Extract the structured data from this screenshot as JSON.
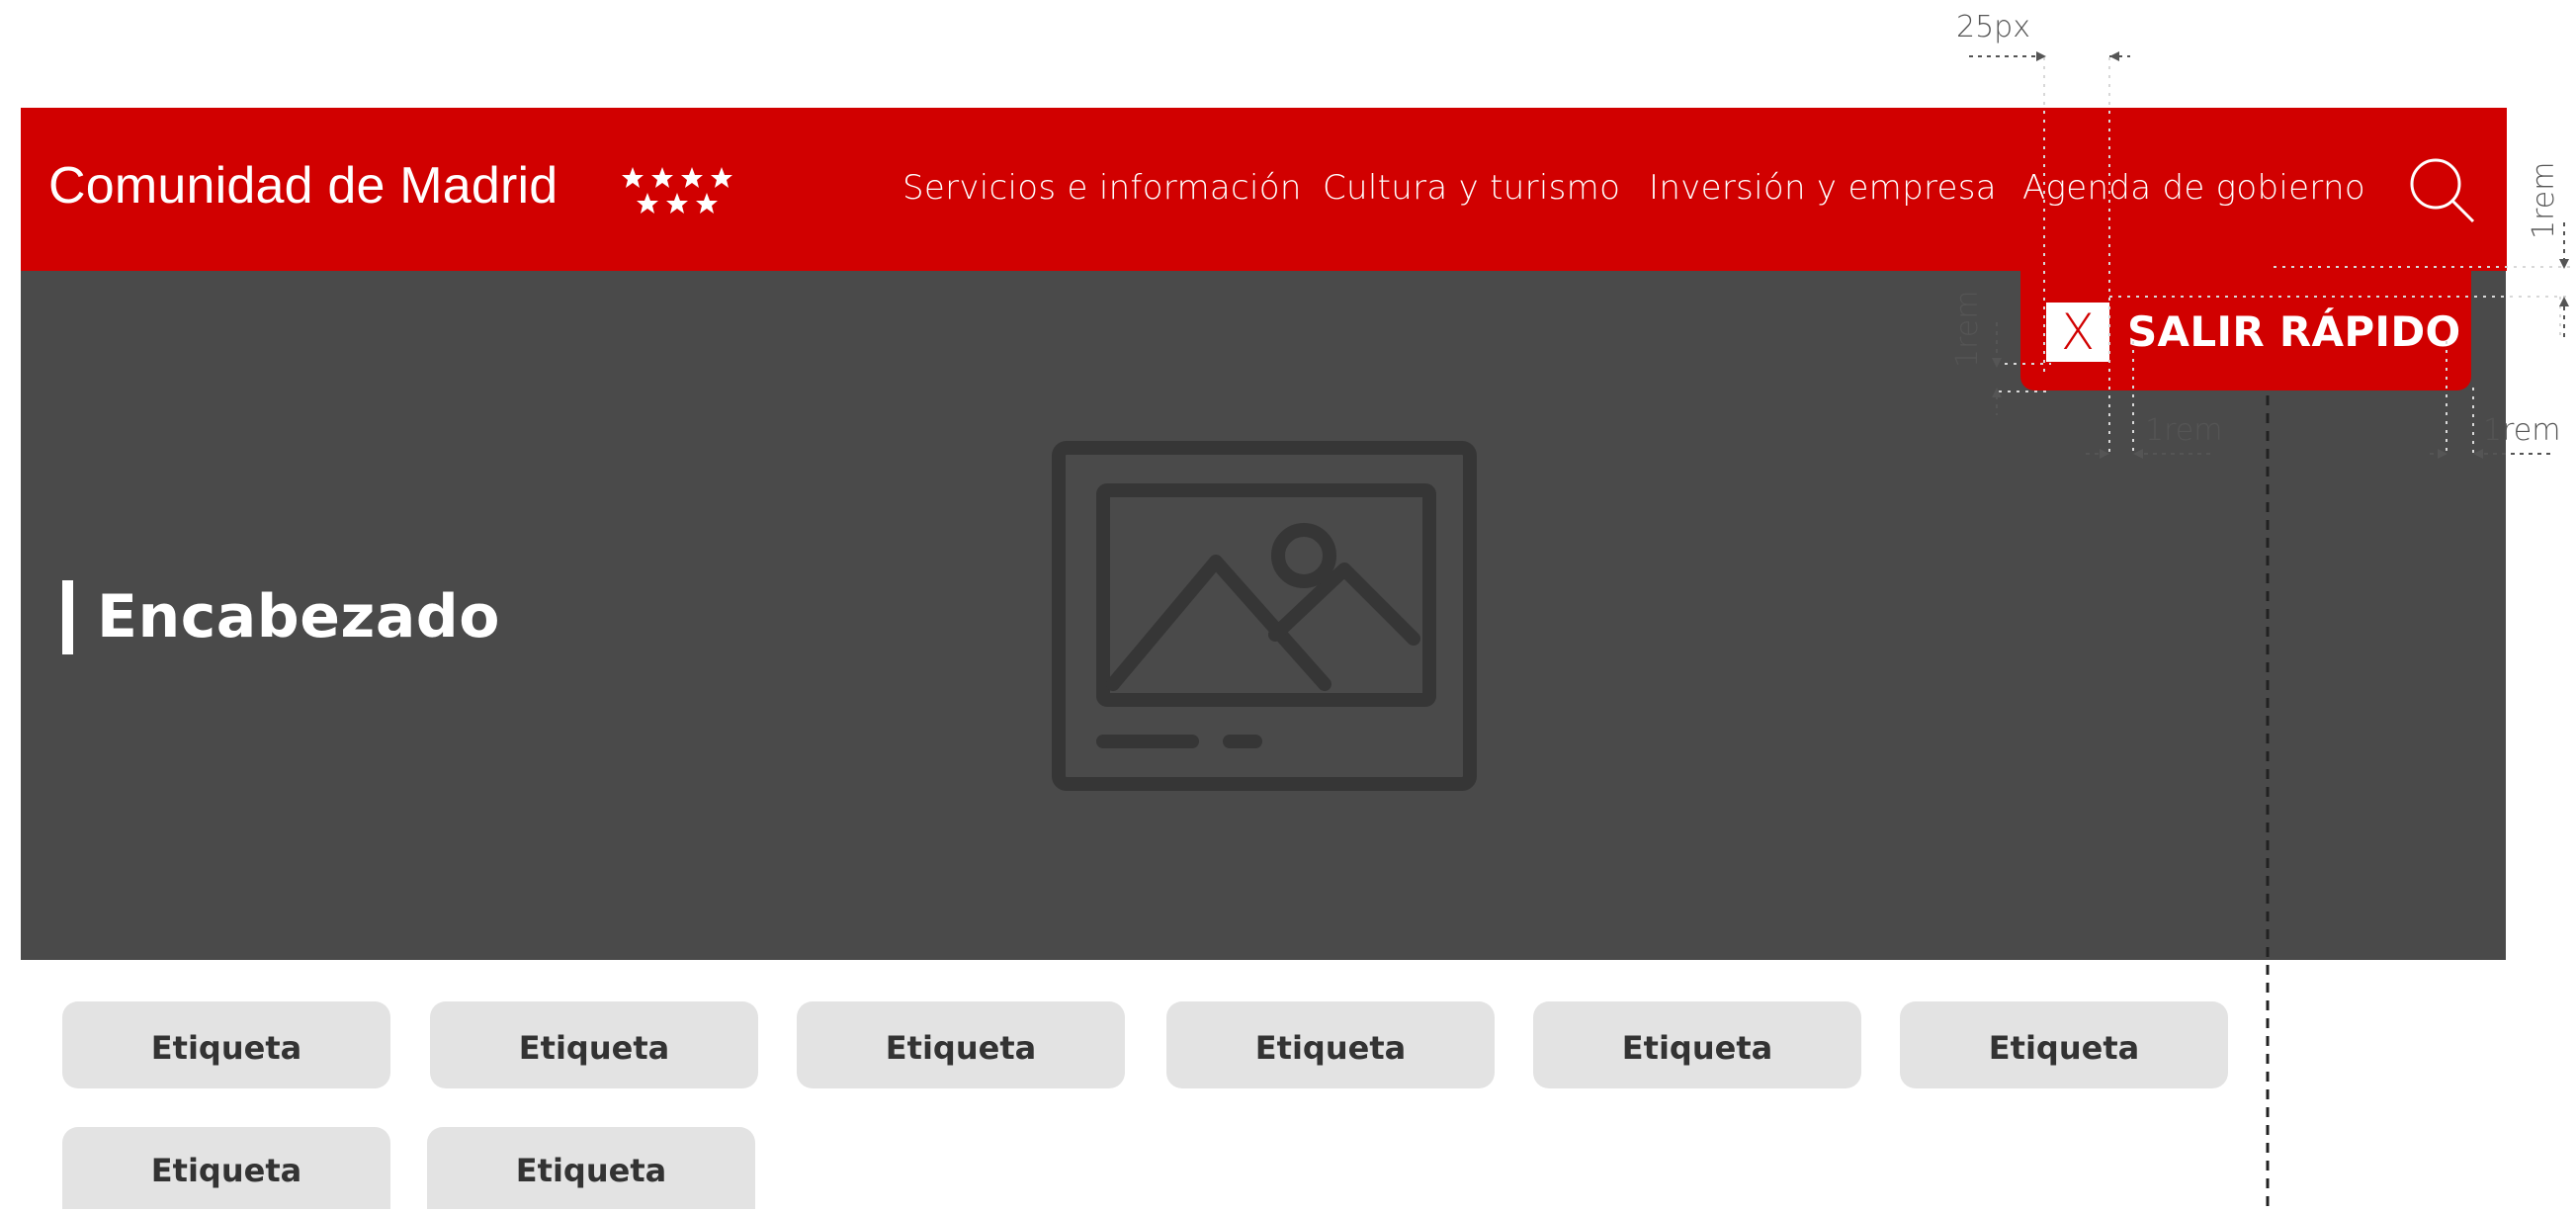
{
  "header": {
    "logo_text": "Comunidad de Madrid",
    "nav": [
      {
        "label": "Servicios e información"
      },
      {
        "label": "Cultura y turismo"
      },
      {
        "label": "Inversión y empresa"
      },
      {
        "label": "Agenda de gobierno"
      }
    ],
    "search_icon": "search-icon"
  },
  "quick_exit": {
    "icon_label": "X",
    "label": "SALIR RÁPIDO"
  },
  "hero": {
    "title": "Encabezado",
    "image_icon": "image-placeholder-icon"
  },
  "tags": [
    "Etiqueta",
    "Etiqueta",
    "Etiqueta",
    "Etiqueta",
    "Etiqueta",
    "Etiqueta",
    "Etiqueta",
    "Etiqueta"
  ],
  "annotations": {
    "top_spacing": "25px",
    "right_spacing": "1rem",
    "left_spacing": "1rem",
    "bottom_left_spacing": "1rem",
    "bottom_right_spacing": "1rem"
  },
  "colors": {
    "brand_red": "#d10000",
    "hero_bg": "#4a4a4a",
    "tag_bg": "#e3e3e3"
  }
}
